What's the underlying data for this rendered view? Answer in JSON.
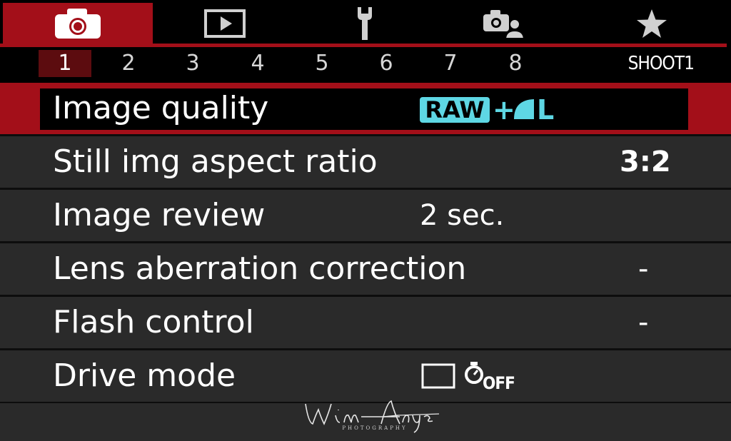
{
  "tabs": [
    {
      "icon": "camera-icon",
      "active": true
    },
    {
      "icon": "play-icon",
      "active": false
    },
    {
      "icon": "wrench-icon",
      "active": false
    },
    {
      "icon": "custom-functions-icon",
      "active": false
    },
    {
      "icon": "star-icon",
      "active": false
    }
  ],
  "pages": {
    "numbers": [
      "1",
      "2",
      "3",
      "4",
      "5",
      "6",
      "7",
      "8"
    ],
    "active": "1",
    "name": "SHOOT1"
  },
  "menu": {
    "image_quality": {
      "label": "Image quality",
      "raw": "RAW",
      "plus": "+",
      "size": "L"
    },
    "aspect_ratio": {
      "label": "Still img aspect ratio",
      "value": "3:2"
    },
    "image_review": {
      "label": "Image review",
      "value": "2 sec."
    },
    "lens_correction": {
      "label": "Lens aberration correction",
      "value": "-"
    },
    "flash_control": {
      "label": "Flash control",
      "value": "-"
    },
    "drive_mode": {
      "label": "Drive mode",
      "off": "OFF"
    }
  },
  "watermark": {
    "signature": "Wim Arys",
    "sub": "PHOTOGRAPHY"
  },
  "colors": {
    "accent": "#a30f19",
    "row": "#2a2a2a",
    "quality": "#5ed7e4"
  }
}
